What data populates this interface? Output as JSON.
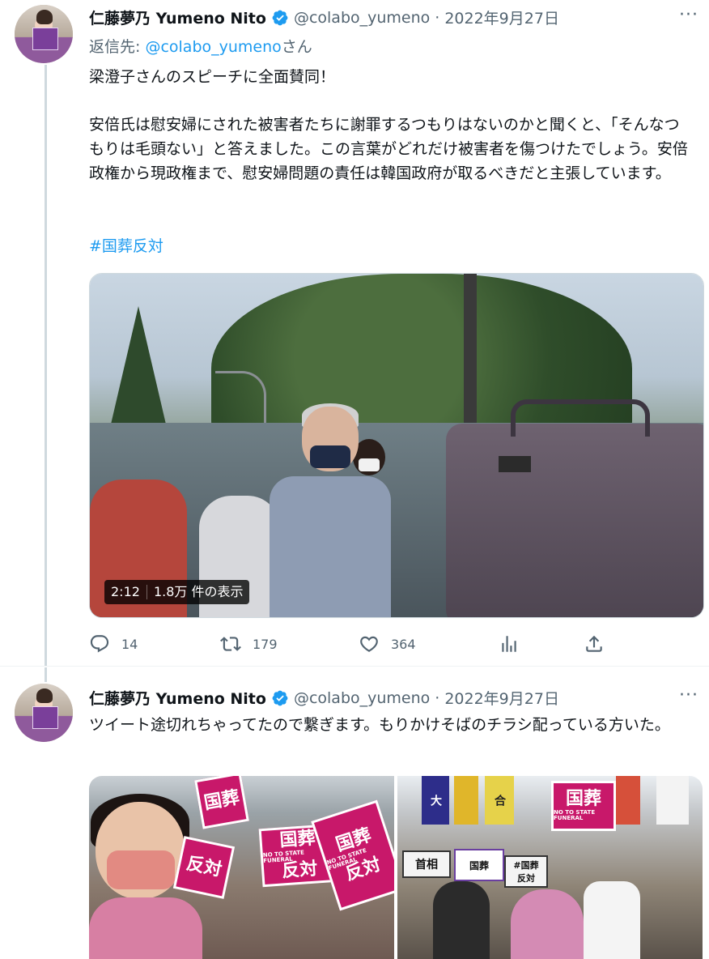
{
  "tweets": [
    {
      "author_name": "仁藤夢乃 Yumeno Nito",
      "handle": "@colabo_yumeno",
      "separator": "·",
      "date": "2022年9月27日",
      "more": "···",
      "reply_prefix": "返信先: ",
      "reply_mention": "@colabo_yumeno",
      "reply_suffix": "さん",
      "text_line1": "梁澄子さんのスピーチに全面賛同！",
      "text_para2": "安倍氏は慰安婦にされた被害者たちに謝罪するつもりはないのかと聞くと、「そんなつもりは毛頭ない」と答えました。この言葉がどれだけ被害者を傷つけたでしょう。安倍政権から現政権まで、慰安婦問題の責任は韓国政府が取るべきだと主張しています。",
      "hashtag": "#国葬反対",
      "video": {
        "duration": "2:12",
        "views": "1.8万 件の表示"
      },
      "actions": {
        "reply_count": "14",
        "retweet_count": "179",
        "like_count": "364"
      }
    },
    {
      "author_name": "仁藤夢乃 Yumeno Nito",
      "handle": "@colabo_yumeno",
      "separator": "·",
      "date": "2022年9月27日",
      "more": "···",
      "text": "ツイート途切れちゃってたので繋ぎます。もりかけそばのチラシ配っている方いた。",
      "photo_signs": {
        "kokuso": "国葬",
        "hantai": "反対",
        "no_state_funeral": "NO TO STATE FUNERAL",
        "hashtag_sign_1": "#国葬",
        "hashtag_sign_2": "反対",
        "shusho": "首相",
        "kaigo": "合",
        "oshu": "大"
      }
    }
  ],
  "colors": {
    "accent": "#1d9bf0",
    "secondary_text": "#536471",
    "primary_text": "#0f1419",
    "thread_line": "#cfd9de",
    "sign_pink": "#c8186a"
  },
  "icons": [
    "verified-badge-icon",
    "more-options-icon",
    "reply-icon",
    "retweet-icon",
    "like-icon",
    "analytics-icon",
    "share-icon"
  ]
}
